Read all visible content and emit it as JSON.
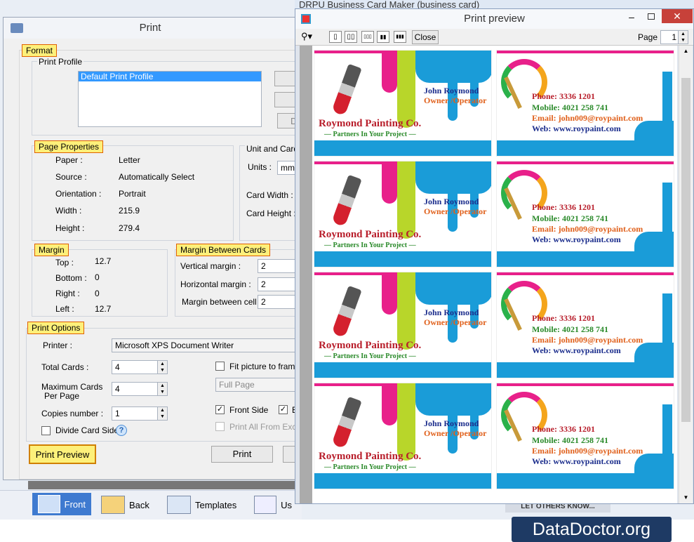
{
  "background_app": {
    "title": "DRPU Business Card Maker (business card)",
    "nav": [
      {
        "label": "Front",
        "icon": "front-card-icon"
      },
      {
        "label": "Back",
        "icon": "back-card-icon"
      },
      {
        "label": "Templates",
        "icon": "templates-icon"
      },
      {
        "label": "Us",
        "icon": "user-icon"
      }
    ],
    "tell_others": "LET OTHERS KNOW..."
  },
  "print_dialog": {
    "title": "Print",
    "format_label": "Format",
    "print_profile_label": "Print Profile",
    "profiles": [
      "Default Print Profile"
    ],
    "profile_buttons": [
      "A",
      "E",
      "D"
    ],
    "page_properties_label": "Page Properties",
    "page_properties": [
      {
        "label": "Paper :",
        "value": "Letter"
      },
      {
        "label": "Source :",
        "value": "Automatically Select"
      },
      {
        "label": "Orientation :",
        "value": "Portrait"
      },
      {
        "label": "Width :",
        "value": "215.9"
      },
      {
        "label": "Height :",
        "value": "279.4"
      }
    ],
    "unit_label": "Unit and Card",
    "units_label": "Units :",
    "units_value": "mm",
    "card_width_label": "Card Width :",
    "card_height_label": "Card Height :",
    "margin_label": "Margin",
    "margins": [
      {
        "label": "Top :",
        "value": "12.7"
      },
      {
        "label": "Bottom :",
        "value": "0"
      },
      {
        "label": "Right :",
        "value": "0"
      },
      {
        "label": "Left :",
        "value": "12.7"
      }
    ],
    "margin_between_label": "Margin Between Cards",
    "margin_between": [
      {
        "label": "Vertical margin :",
        "value": "2"
      },
      {
        "label": "Horizontal margin :",
        "value": "2"
      },
      {
        "label": "Margin between cell :",
        "value": "2"
      }
    ],
    "print_options_label": "Print Options",
    "printer_label": "Printer :",
    "printer_value": "Microsoft XPS Document Writer",
    "total_cards_label": "Total Cards :",
    "total_cards_value": "4",
    "max_cards_label_1": "Maximum Cards",
    "max_cards_label_2": "Per Page",
    "max_cards_value": "4",
    "copies_label": "Copies number :",
    "copies_value": "1",
    "divide_card_label": "Divide Card Side",
    "help_symbol": "?",
    "fit_picture_label": "Fit picture to fram",
    "full_page_value": "Full Page",
    "front_side_label": "Front Side",
    "back_side_label": "E",
    "print_all_excel_label": "Print All From Excel",
    "print_preview_button": "Print Preview",
    "print_button": "Print"
  },
  "print_preview": {
    "title": "Print preview",
    "close_button": "Close",
    "page_label": "Page",
    "page_value": "1",
    "cards": {
      "name": "John Roymond",
      "role": "Owner /Operator",
      "company": "Roymond Painting Co.",
      "tagline": "Partners In Your Project",
      "phone": "Phone: 3336 1201",
      "mobile": "Mobile: 4021 258 741",
      "email": "Email: john009@roypaint.com",
      "web": "Web: www.roypaint.com"
    },
    "rows": 4
  },
  "watermark": "DataDoctor.org",
  "colors": {
    "highlight": "#fdf07a",
    "card_blue": "#1a9cd8",
    "card_pink": "#e8208a",
    "brand_bg": "#1e3a64"
  }
}
